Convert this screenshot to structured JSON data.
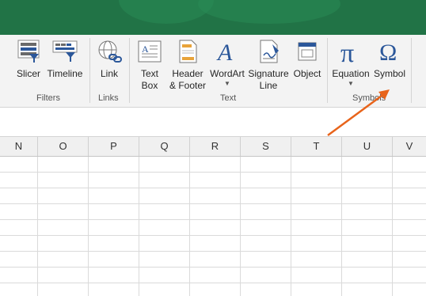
{
  "ribbon": {
    "filters": {
      "group_label": "Filters",
      "slicer": "Slicer",
      "timeline": "Timeline"
    },
    "links": {
      "group_label": "Links",
      "link": "Link"
    },
    "text": {
      "group_label": "Text",
      "textbox": [
        "Text",
        "Box"
      ],
      "header_footer": [
        "Header",
        "& Footer"
      ],
      "wordart": "WordArt",
      "signature": [
        "Signature",
        "Line"
      ],
      "object": "Object"
    },
    "symbols": {
      "group_label": "Symbols",
      "equation": "Equation",
      "symbol": "Symbol"
    }
  },
  "columns": [
    "N",
    "O",
    "P",
    "Q",
    "R",
    "S",
    "T",
    "U",
    "V"
  ],
  "colors": {
    "titlebar": "#217346",
    "accent_blue": "#2b579a",
    "arrow": "#e8641b"
  }
}
